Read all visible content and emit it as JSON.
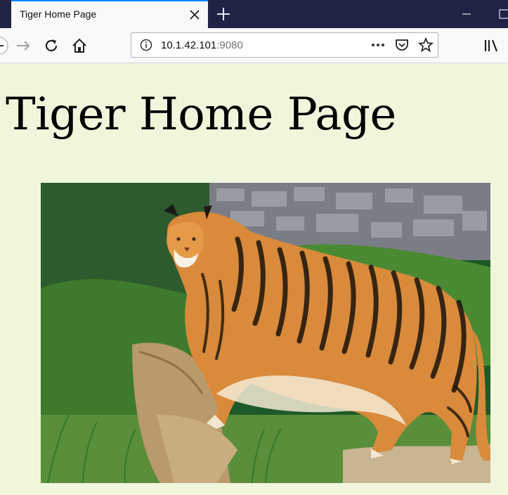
{
  "browser": {
    "tab_title": "Tiger Home Page",
    "url_host": "10.1.42.101",
    "url_port": ":9080",
    "icons": [
      "back-icon",
      "forward-icon",
      "reload-icon",
      "home-icon",
      "info-icon",
      "more-icon",
      "pocket-icon",
      "star-icon",
      "library-icon",
      "close-icon",
      "plus-icon"
    ]
  },
  "page": {
    "heading": "Tiger Home Page",
    "image": {
      "subject": "tiger",
      "background_color": "#f0f6dc"
    }
  }
}
